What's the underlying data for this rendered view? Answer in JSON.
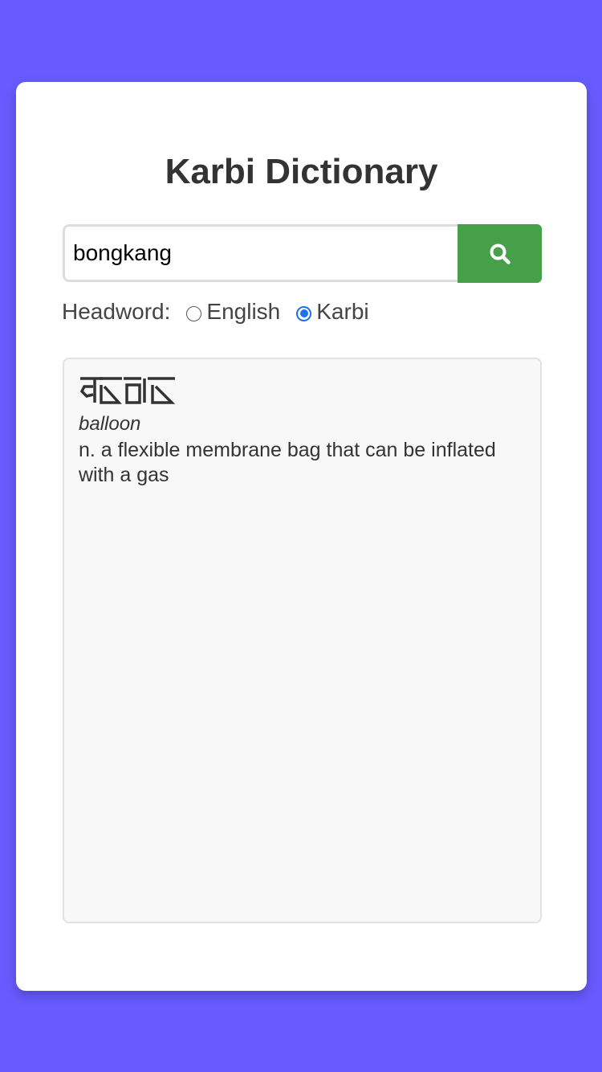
{
  "app": {
    "title": "Karbi Dictionary"
  },
  "search": {
    "value": "bongkang",
    "button_icon": "search-icon"
  },
  "headword": {
    "label": "Headword:",
    "options": [
      {
        "label": "English",
        "selected": false
      },
      {
        "label": "Karbi",
        "selected": true
      }
    ]
  },
  "result": {
    "headword_script": "Karbi script headword (drawn as glyph shapes)",
    "gloss": "balloon",
    "definition": "n. a flexible membrane bag that can be inflated with a gas"
  },
  "colors": {
    "background": "#675bff",
    "accent": "#45a049",
    "radio_selected": "#1a73e8"
  }
}
